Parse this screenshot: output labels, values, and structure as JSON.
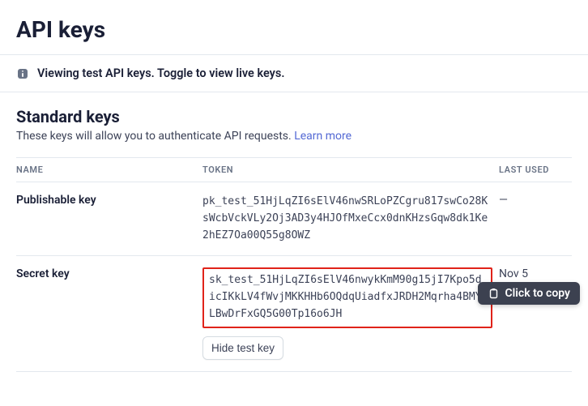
{
  "header": {
    "title": "API keys"
  },
  "notice": {
    "text": "Viewing test API keys. Toggle to view live keys."
  },
  "section": {
    "title": "Standard keys",
    "description_prefix": "These keys will allow you to authenticate API requests. ",
    "learn_more": "Learn more"
  },
  "table": {
    "cols": {
      "name": "NAME",
      "token": "TOKEN",
      "last_used": "LAST USED"
    },
    "rows": [
      {
        "name": "Publishable key",
        "token": "pk_test_51HjLqZI6sElV46nwSRLoPZCgru817swCo28KsWcbVckVLy2Oj3AD3y4HJOfMxeCcx0dnKHzsGqw8dk1Ke2hEZ7Oa00Q55g8OWZ",
        "last_used": "—",
        "highlight": false
      },
      {
        "name": "Secret key",
        "token": "sk_test_51HjLqZI6sElV46nwykKmM90g15jI7Kpo5dicIKkLV4fWvjMKKHHb6OQdqUiadfxJRDH2Mqrha4BMYLBwDrFxGQ5G00Tp16o6JH",
        "last_used": "Nov 5",
        "highlight": true
      }
    ],
    "hide_button": "Hide test key"
  },
  "tooltip": {
    "label": "Click to copy"
  }
}
